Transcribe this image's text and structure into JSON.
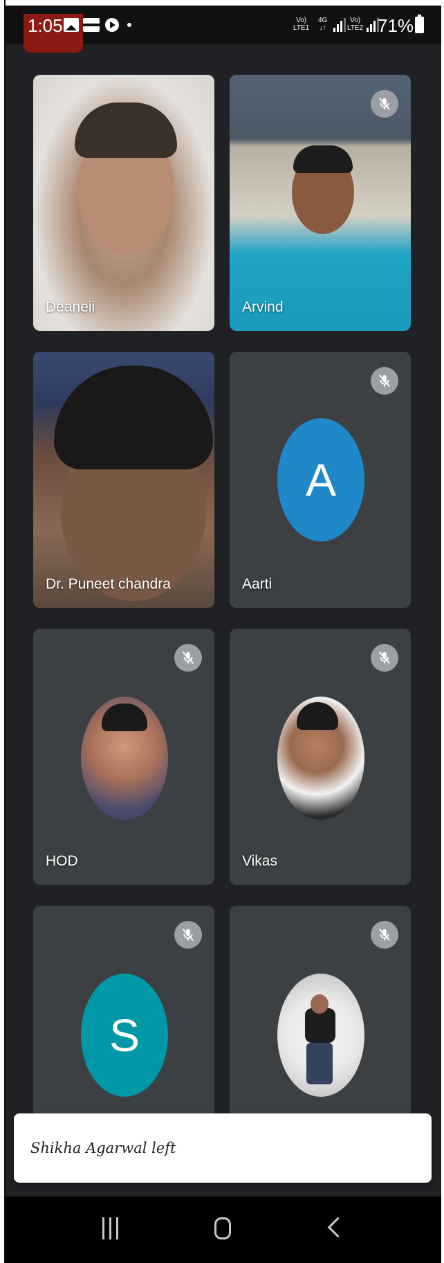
{
  "status_bar": {
    "time": "1:05",
    "sim1_label": "Vo)",
    "sim1_sub": "LTE1",
    "net_type": "4G",
    "sim2_label": "Vo)",
    "sim2_sub": "LTE2",
    "battery": "71%"
  },
  "participants": [
    {
      "name": "Deaneii",
      "muted": false,
      "view": "video"
    },
    {
      "name": "Arvind",
      "muted": true,
      "view": "video"
    },
    {
      "name": "Dr. Puneet chandra",
      "muted": false,
      "view": "video"
    },
    {
      "name": "Aarti",
      "muted": true,
      "view": "letter",
      "avatar_letter": "A",
      "avatar_color": "#1e88c9"
    },
    {
      "name": "HOD",
      "muted": true,
      "view": "photo"
    },
    {
      "name": "Vikas",
      "muted": true,
      "view": "photo"
    },
    {
      "name": "",
      "muted": true,
      "view": "letter",
      "avatar_letter": "S",
      "avatar_color": "#0097a7"
    },
    {
      "name": "",
      "muted": true,
      "view": "photo"
    }
  ],
  "toast": {
    "message": "Shikha Agarwal left"
  },
  "icons": {
    "mic_off": "mic-off-icon",
    "nav_recent": "recent-apps-icon",
    "nav_home": "home-icon",
    "nav_back": "back-icon"
  }
}
